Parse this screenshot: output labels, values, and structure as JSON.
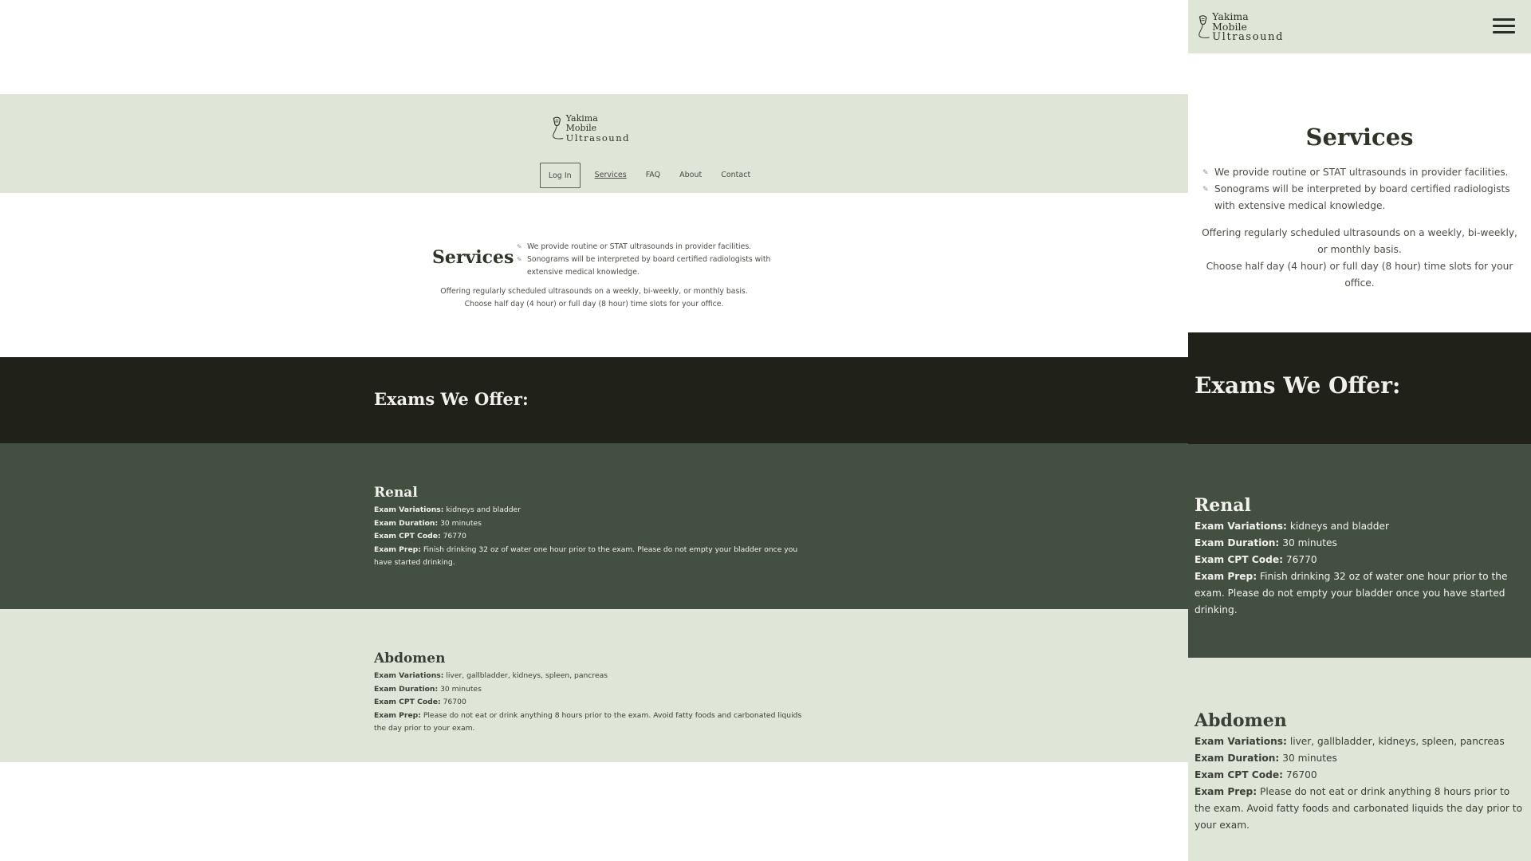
{
  "brand": {
    "name_line1": "Yakima Mobile",
    "name_line2": "Ultrasound"
  },
  "nav": {
    "login": "Log In",
    "services": "Services",
    "faq": "FAQ",
    "about": "About",
    "contact": "Contact"
  },
  "services": {
    "title": "Services",
    "bullets": [
      "We provide routine or STAT ultrasounds in provider facilities.",
      "Sonograms will be interpreted by board certified radiologists with extensive medical knowledge."
    ],
    "offer_line1": "Offering regularly scheduled ultrasounds on a weekly, bi-weekly, or monthly basis.",
    "offer_line2": "Choose half day (4 hour) or full day (8 hour) time slots for your office."
  },
  "exams_heading": "Exams We Offer:",
  "labels": {
    "variations": "Exam Variations:",
    "duration": "Exam Duration:",
    "cpt": "Exam CPT Code:",
    "prep": "Exam Prep:"
  },
  "exams": [
    {
      "name": "Renal",
      "variations": "kidneys and bladder",
      "duration": "30 minutes",
      "cpt": "76770",
      "prep": "Finish drinking 32 oz of water one hour prior to the exam. Please do not empty your bladder once you have started drinking."
    },
    {
      "name": "Abdomen",
      "variations": "liver, gallbladder, kidneys, spleen, pancreas",
      "duration": "30 minutes",
      "cpt": "76700",
      "prep": "Please do not eat or drink anything 8 hours prior to the exam. Avoid fatty foods and carbonated liquids the day prior to your exam."
    }
  ],
  "icons": {
    "logo": "ultrasound-probe-icon",
    "menu": "hamburger-menu-icon",
    "bullet": "pencil-bullet-icon"
  },
  "colors": {
    "sage": "#dfe5d7",
    "dark": "#202118",
    "forest": "#434f40"
  }
}
